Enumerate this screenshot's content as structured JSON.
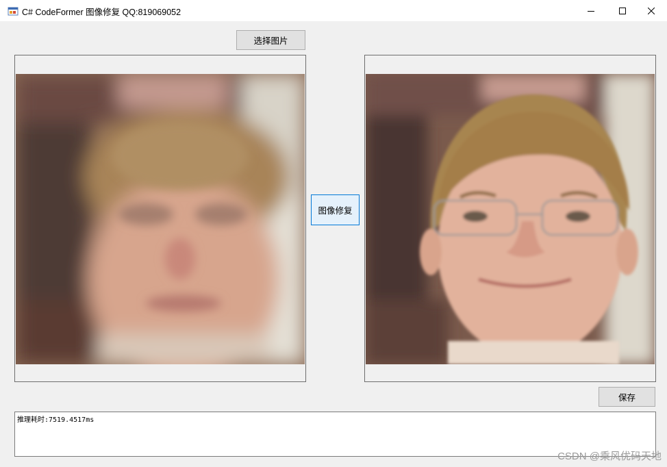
{
  "window": {
    "title": "C# CodeFormer 图像修复 QQ:819069052",
    "icon": "winforms-app-icon",
    "controls": [
      "minimize-icon",
      "maximize-icon",
      "close-icon"
    ]
  },
  "buttons": {
    "select_image": "选择图片",
    "restore": "图像修复",
    "save": "保存"
  },
  "images": {
    "input": "blurry low-quality face photo",
    "output": "restored sharp face photo"
  },
  "output_log": "推理耗时:7519.4517ms",
  "watermark": "CSDN @乘风优码天地"
}
